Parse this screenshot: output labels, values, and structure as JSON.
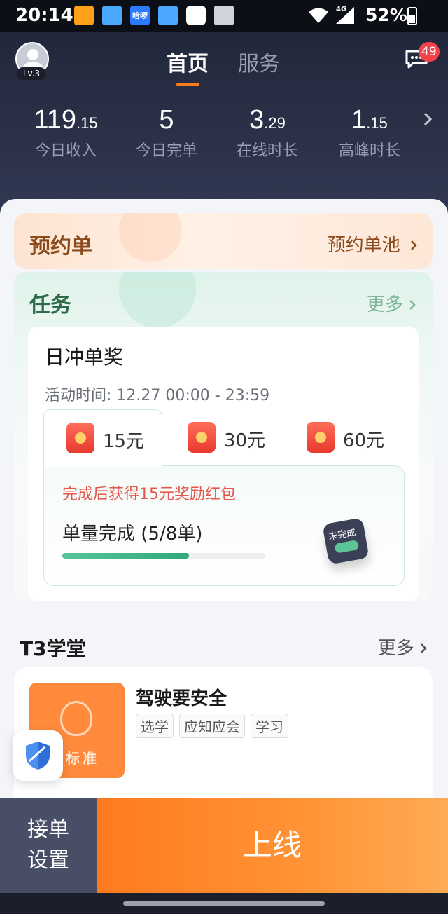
{
  "status_bar": {
    "time": "20:14",
    "app_hallo": "哈啰",
    "network": "4G",
    "battery": "52%",
    "battery_level": 0.52
  },
  "header": {
    "level": "Lv.3",
    "tabs": [
      {
        "label": "首页",
        "active": true
      },
      {
        "label": "服务",
        "active": false
      }
    ],
    "messages_count": "49",
    "accent_color": "#ff7a1a"
  },
  "stats": [
    {
      "int": "119",
      "dec": ".15",
      "label": "今日收入"
    },
    {
      "int": "5",
      "dec": "",
      "label": "今日完单"
    },
    {
      "int": "3",
      "dec": ".29",
      "label": "在线时长"
    },
    {
      "int": "1",
      "dec": ".15",
      "label": "高峰时长"
    }
  ],
  "reserve": {
    "title": "预约单",
    "link": "预约单池"
  },
  "task": {
    "title": "任务",
    "more": "更多",
    "card": {
      "title": "日冲单奖",
      "time": "活动时间: 12.27 00:00 - 23:59",
      "rewards": [
        "15元",
        "30元",
        "60元"
      ],
      "selected_reward_index": 0,
      "reward_message": "完成后获得15元奖励红包",
      "progress_label": "单量完成 (5/8单)",
      "progress_fraction": 0.625,
      "status_badge": "未完成"
    }
  },
  "school": {
    "title": "T3学堂",
    "more": "更多",
    "course": {
      "thumb_text": "务标准",
      "title": "驾驶要安全",
      "tags": [
        "选学",
        "应知应会",
        "学习"
      ]
    }
  },
  "bottom": {
    "order_setting_line1": "接单",
    "order_setting_line2": "设置",
    "online": "上线"
  }
}
